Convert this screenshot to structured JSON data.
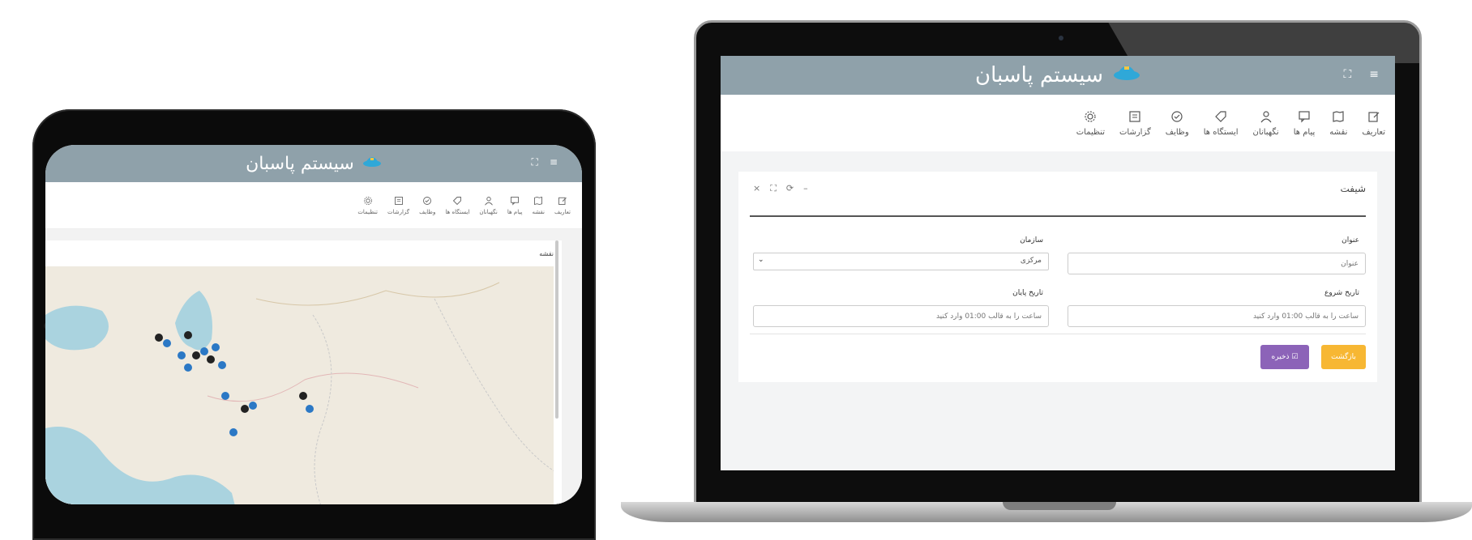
{
  "app": {
    "title": "سیستم پاسبان"
  },
  "toolbar": {
    "items": [
      {
        "label": "تعاریف",
        "icon": "edit-icon"
      },
      {
        "label": "نقشه",
        "icon": "map-icon"
      },
      {
        "label": "پیام ها",
        "icon": "message-icon"
      },
      {
        "label": "نگهبانان",
        "icon": "user-icon"
      },
      {
        "label": "ایستگاه ها",
        "icon": "tag-icon"
      },
      {
        "label": "وظایف",
        "icon": "check-circle-icon"
      },
      {
        "label": "گزارشات",
        "icon": "report-icon"
      },
      {
        "label": "تنظیمات",
        "icon": "gear-icon"
      }
    ]
  },
  "tablet": {
    "card_title": "نقشه"
  },
  "laptop": {
    "card_title": "شیفت",
    "card_tools": [
      "×",
      "⛶",
      "⟳",
      "–"
    ],
    "form": {
      "title_label": "عنوان",
      "title_placeholder": "عنوان",
      "org_label": "سازمان",
      "org_value": "مرکزی",
      "start_label": "تاریخ شروع",
      "start_placeholder": "ساعت را به قالب 01:00 وارد کنید",
      "end_label": "تاریخ پایان",
      "end_placeholder": "ساعت را به قالب 01:00 وارد کنید"
    },
    "buttons": {
      "back": "بازگشت",
      "save": "☑ ذخیره"
    }
  },
  "colors": {
    "header": "#8fa1aa",
    "logo": "#2fa8d8",
    "back_button": "#f7b733",
    "save_button": "#8c63b8"
  }
}
